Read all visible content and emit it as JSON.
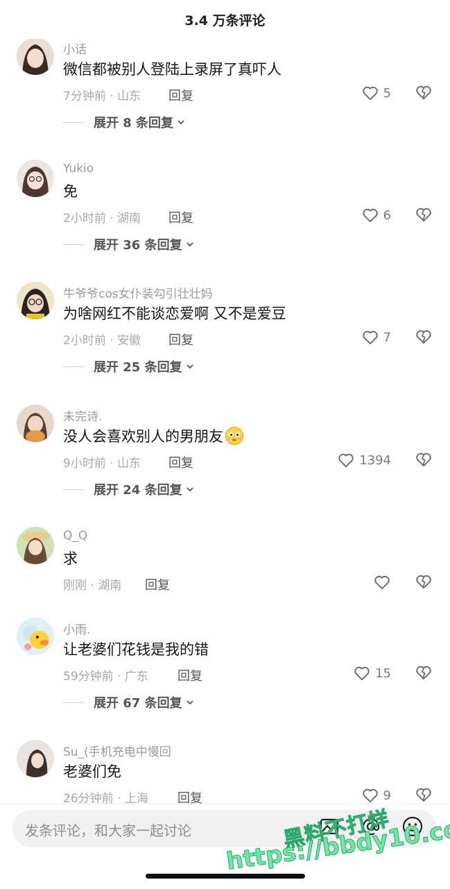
{
  "header": {
    "title": "3.4 万条评论"
  },
  "comments": [
    {
      "user": "小话",
      "text": "微信都被别人登陆上录屏了真吓人",
      "time": "7分钟前 · 山东",
      "reply": "回复",
      "likes": "5",
      "expand": "展开 8 条回复"
    },
    {
      "user": "Yukio",
      "text": "免",
      "time": "2小时前 · 湖南",
      "reply": "回复",
      "likes": "6",
      "expand": "展开 36 条回复"
    },
    {
      "user": "牛爷爷cos女仆装勾引壮壮妈",
      "text": "为啥网红不能谈恋爱啊 又不是爱豆",
      "time": "2小时前 · 安徽",
      "reply": "回复",
      "likes": "7",
      "expand": "展开 25 条回复"
    },
    {
      "user": "未完诗.",
      "text": "没人会喜欢别人的男朋友",
      "time": "9小时前 · 山东",
      "reply": "回复",
      "likes": "1394",
      "expand": "展开 24 条回复"
    },
    {
      "user": "Q_Q",
      "text": "求",
      "time": "刚刚 · 湖南",
      "reply": "回复",
      "likes": "",
      "expand": ""
    },
    {
      "user": "小雨.",
      "text": "让老婆们花钱是我的错",
      "time": "59分钟前 · 广东",
      "reply": "回复",
      "likes": "15",
      "expand": "展开 67 条回复"
    },
    {
      "user": "Su_(手机充电中慢回",
      "text": "老婆们免",
      "time": "26分钟前 · 上海",
      "reply": "回复",
      "likes": "9",
      "expand": ""
    }
  ],
  "footer": {
    "placeholder": "发条评论，和大家一起讨论",
    "watermark_top": "黑料不打烊",
    "watermark_bottom": "https://bbdy10.com"
  },
  "colors": {
    "meta": "#a8a8a8",
    "text": "#161616",
    "watermark": "#73e6a6"
  },
  "icons": [
    "heart-icon",
    "broken-heart-icon",
    "chevron-down-icon",
    "image-icon",
    "at-icon",
    "emoji-icon",
    "sticker-face-emoji"
  ]
}
